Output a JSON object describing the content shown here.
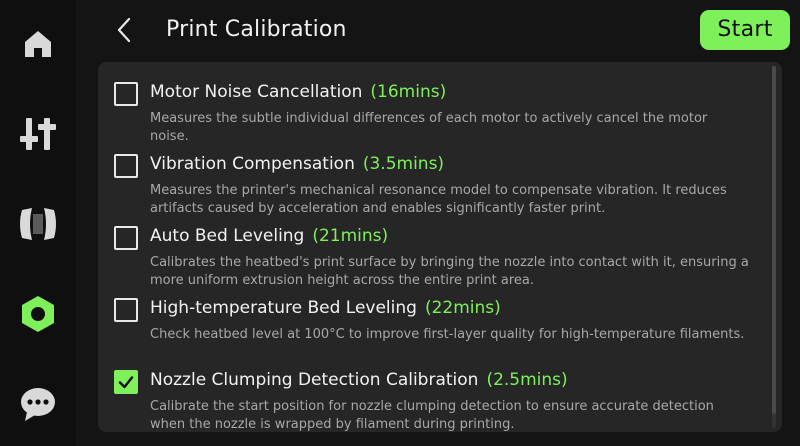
{
  "header": {
    "title": "Print Calibration",
    "start_label": "Start"
  },
  "sidebar": {
    "items": [
      {
        "icon": "home-icon"
      },
      {
        "icon": "controls-icon"
      },
      {
        "icon": "filament-icon"
      },
      {
        "icon": "settings-icon",
        "active": true
      },
      {
        "icon": "chat-icon"
      }
    ]
  },
  "colors": {
    "accent": "#7ef05a",
    "background": "#141414",
    "panel": "#262626",
    "desc_text": "#a8a8a8"
  },
  "calibrations": [
    {
      "title": "Motor Noise Cancellation",
      "duration": "(16mins)",
      "description": "Measures the subtle individual differences of each motor to actively cancel the motor noise.",
      "checked": false
    },
    {
      "title": "Vibration Compensation",
      "duration": "(3.5mins)",
      "description": "Measures the printer's mechanical resonance model to compensate vibration. It reduces artifacts caused by acceleration and enables significantly faster print.",
      "checked": false
    },
    {
      "title": "Auto Bed Leveling",
      "duration": "(21mins)",
      "description": "Calibrates the heatbed's print surface by bringing the nozzle into contact with it, ensuring a more uniform extrusion height across the entire print area.",
      "checked": false
    },
    {
      "title": "High-temperature Bed Leveling",
      "duration": "(22mins)",
      "description": "Check heatbed level at 100°C to improve first-layer quality for high-temperature filaments.",
      "checked": false
    },
    {
      "title": "Nozzle Clumping Detection Calibration",
      "duration": "(2.5mins)",
      "description": "Calibrate the start position for nozzle clumping detection to ensure accurate detection when the nozzle is wrapped by filament during printing.",
      "checked": true
    }
  ]
}
